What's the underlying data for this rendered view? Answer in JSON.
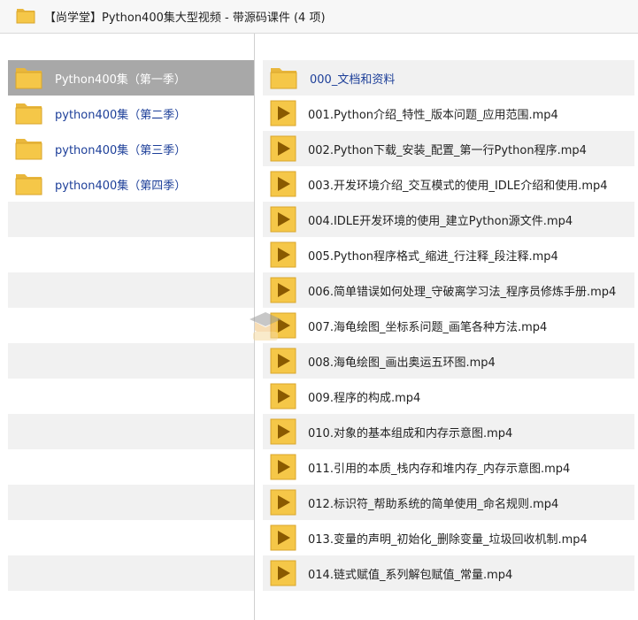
{
  "window": {
    "title": "【尚学堂】Python400集大型视频 - 带源码课件 (4 项)"
  },
  "sidebar": {
    "items": [
      {
        "label": "Python400集（第一季）",
        "icon": "folder-icon",
        "selected": true
      },
      {
        "label": "python400集（第二季）",
        "icon": "folder-icon",
        "selected": false
      },
      {
        "label": "python400集（第三季）",
        "icon": "folder-icon",
        "selected": false
      },
      {
        "label": "python400集（第四季）",
        "icon": "folder-icon",
        "selected": false
      }
    ],
    "empty_rows": 10
  },
  "files": {
    "items": [
      {
        "label": "000_文档和资料",
        "icon": "folder-icon"
      },
      {
        "label": "001.Python介绍_特性_版本问题_应用范围.mp4",
        "icon": "video-file-icon"
      },
      {
        "label": "002.Python下载_安装_配置_第一行Python程序.mp4",
        "icon": "video-file-icon"
      },
      {
        "label": "003.开发环境介绍_交互模式的使用_IDLE介绍和使用.mp4",
        "icon": "video-file-icon"
      },
      {
        "label": "004.IDLE开发环境的使用_建立Python源文件.mp4",
        "icon": "video-file-icon"
      },
      {
        "label": "005.Python程序格式_缩进_行注释_段注释.mp4",
        "icon": "video-file-icon"
      },
      {
        "label": "006.简单错误如何处理_守破离学习法_程序员修炼手册.mp4",
        "icon": "video-file-icon"
      },
      {
        "label": "007.海龟绘图_坐标系问题_画笔各种方法.mp4",
        "icon": "video-file-icon"
      },
      {
        "label": "008.海龟绘图_画出奥运五环图.mp4",
        "icon": "video-file-icon"
      },
      {
        "label": "009.程序的构成.mp4",
        "icon": "video-file-icon"
      },
      {
        "label": "010.对象的基本组成和内存示意图.mp4",
        "icon": "video-file-icon"
      },
      {
        "label": "011.引用的本质_栈内存和堆内存_内存示意图.mp4",
        "icon": "video-file-icon"
      },
      {
        "label": "012.标识符_帮助系统的简单使用_命名规则.mp4",
        "icon": "video-file-icon"
      },
      {
        "label": "013.变量的声明_初始化_删除变量_垃圾回收机制.mp4",
        "icon": "video-file-icon"
      },
      {
        "label": "014.链式赋值_系列解包赋值_常量.mp4",
        "icon": "video-file-icon"
      }
    ]
  },
  "colors": {
    "folder": "#f5c748",
    "video_icon": "#e8a514",
    "selected_row": "#a8a8a8",
    "alt_row": "#f1f1f1",
    "link_text": "#1d3f99"
  }
}
